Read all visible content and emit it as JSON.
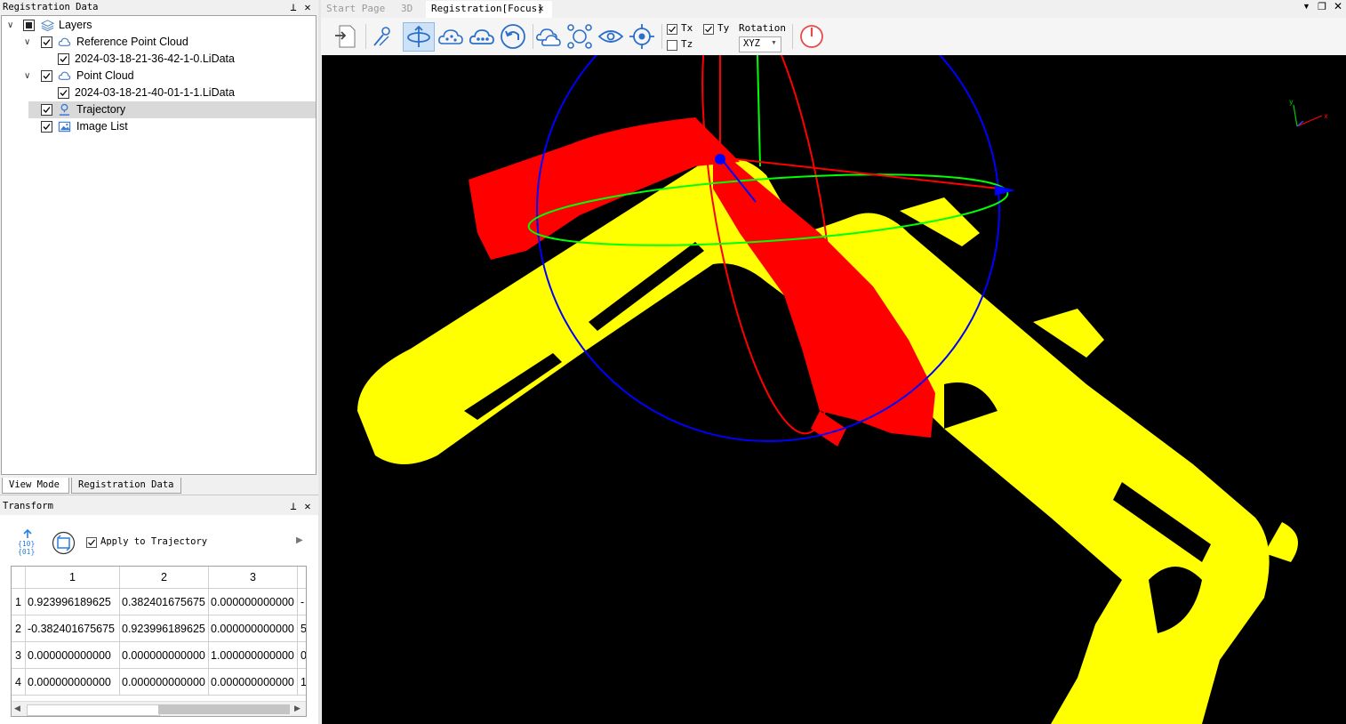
{
  "registration_panel": {
    "title": "Registration Data",
    "tree": {
      "root": "Layers",
      "reference_group": "Reference Point Cloud",
      "reference_file": "2024-03-18-21-36-42-1-0.LiData",
      "point_group": "Point Cloud",
      "point_file": "2024-03-18-21-40-01-1-1.LiData",
      "trajectory": "Trajectory",
      "image_list": "Image List"
    },
    "bottom_tabs": [
      "View Mode",
      "Registration Data"
    ]
  },
  "transform_panel": {
    "title": "Transform",
    "apply_label": "Apply to Trajectory",
    "apply_checked": true,
    "col_headers": [
      "1",
      "2",
      "3"
    ],
    "row_headers": [
      "1",
      "2",
      "3",
      "4"
    ],
    "rows": [
      [
        "0.923996189625",
        "0.382401675675",
        "0.000000000000",
        "-"
      ],
      [
        "-0.382401675675",
        "0.923996189625",
        "0.000000000000",
        "5"
      ],
      [
        "0.000000000000",
        "0.000000000000",
        "1.000000000000",
        "0"
      ],
      [
        "0.000000000000",
        "0.000000000000",
        "0.000000000000",
        "1"
      ]
    ]
  },
  "doc_tabs": {
    "start": "Start Page",
    "view3d": "3D",
    "registration": "Registration[Focus]"
  },
  "toolbar": {
    "tx": "Tx",
    "ty": "Ty",
    "tz": "Tz",
    "tx_checked": true,
    "ty_checked": true,
    "tz_checked": false,
    "rotation_label": "Rotation",
    "rotation_value": "XYZ"
  },
  "axis_labels": {
    "x": "x",
    "y": "y"
  },
  "colors": {
    "reference_cloud": "#ff0000",
    "point_cloud": "#ffff00",
    "gizmo_x": "#ff0000",
    "gizmo_y": "#00ff00",
    "gizmo_z": "#0000ff",
    "active_tool": "#cde1f7",
    "power": "#e84a4a"
  }
}
